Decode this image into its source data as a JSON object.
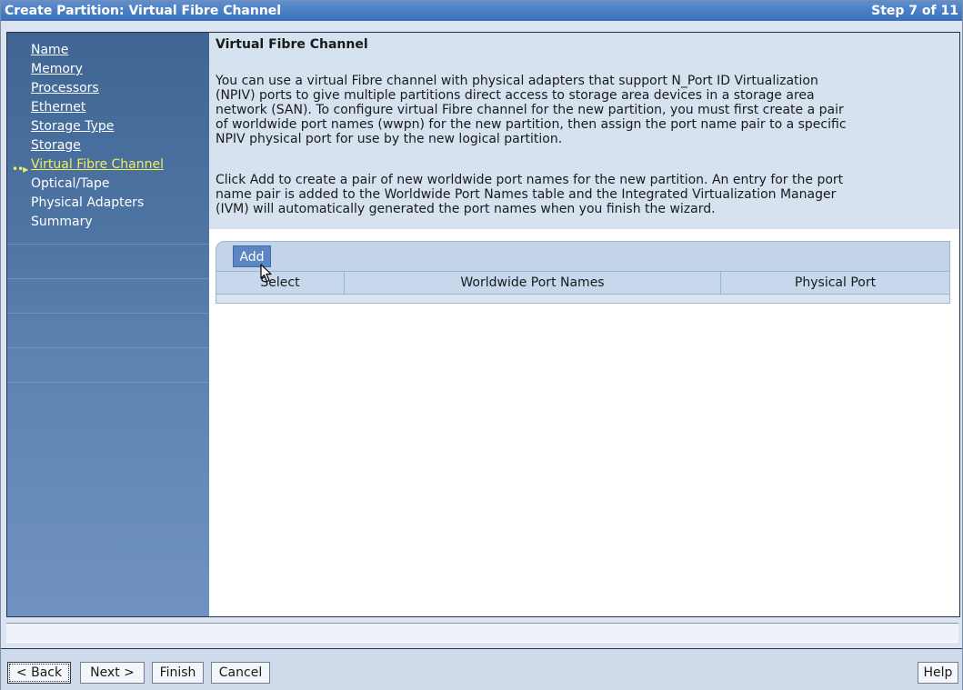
{
  "window": {
    "title": "Create Partition: Virtual Fibre Channel",
    "step": "Step 7 of 11"
  },
  "nav": {
    "current_marker": "••▸",
    "items": [
      {
        "label": "Name",
        "state": "link"
      },
      {
        "label": "Memory",
        "state": "link"
      },
      {
        "label": "Processors",
        "state": "link"
      },
      {
        "label": "Ethernet",
        "state": "link"
      },
      {
        "label": "Storage Type",
        "state": "link"
      },
      {
        "label": "Storage",
        "state": "link"
      },
      {
        "label": "Virtual Fibre Channel",
        "state": "current"
      },
      {
        "label": "Optical/Tape",
        "state": "plain"
      },
      {
        "label": "Physical Adapters",
        "state": "plain"
      },
      {
        "label": "Summary",
        "state": "plain"
      }
    ]
  },
  "content": {
    "heading": "Virtual Fibre Channel",
    "para1_lines": [
      "You can use a virtual Fibre channel with physical adapters that support N_Port ID Virtualization",
      "(NPIV) ports to give multiple partitions direct access to storage area devices in a storage area",
      "network (SAN). To configure virtual Fibre channel for the new partition, you must first create a pair",
      "of worldwide port names (wwpn) for the new partition, then assign the port name pair to a specific",
      "NPIV physical port for use by the new logical partition."
    ],
    "para2_lines": [
      "Click Add to create a pair of new worldwide port names for the new partition. An entry for the port",
      "name pair is added to the Worldwide Port Names table and the Integrated Virtualization Manager",
      "(IVM) will automatically generated the port names when you finish the wizard."
    ]
  },
  "table": {
    "add_label": "Add",
    "columns": [
      "Select",
      "Worldwide Port Names",
      "Physical Port"
    ],
    "rows": []
  },
  "footer": {
    "back": "< Back",
    "next": "Next >",
    "finish": "Finish",
    "cancel": "Cancel",
    "help": "Help"
  },
  "colors": {
    "title_bar": "#3a6fb8",
    "nav_bg": "#4f76a5",
    "current_item": "#f5ec5c",
    "description_bg": "#d6e2f0",
    "add_button": "#5b86c2"
  }
}
